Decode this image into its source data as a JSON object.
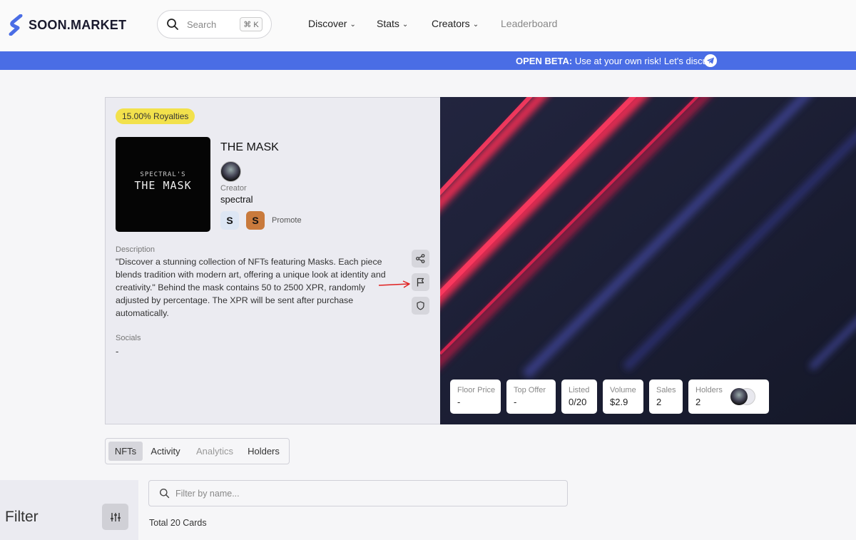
{
  "header": {
    "logo_text": "SOON.MARKET",
    "search_placeholder": "Search",
    "search_shortcut": "⌘ K",
    "nav": [
      {
        "label": "Discover"
      },
      {
        "label": "Stats"
      },
      {
        "label": "Creators"
      },
      {
        "label": "Leaderboard"
      }
    ]
  },
  "banner": {
    "strong": "OPEN BETA:",
    "text": " Use at your own risk! Let's discuss"
  },
  "collection": {
    "royalties": "15.00% Royalties",
    "cover_subtitle": "SPECTRAL'S",
    "cover_title": "THE MASK",
    "title": "THE MASK",
    "creator_label": "Creator",
    "creator_name": "spectral",
    "badge_a": "S",
    "badge_b": "S",
    "promote_label": "Promote",
    "description_label": "Description",
    "description": "\"Discover a stunning collection of NFTs featuring Masks. Each piece blends tradition with modern art, offering a unique look at identity and creativity.\" Behind the mask contains 50 to 2500 XPR, randomly adjusted by percentage. The XPR will be sent after purchase automatically.",
    "socials_label": "Socials",
    "socials_value": "-"
  },
  "stats": {
    "floor_price": {
      "label": "Floor Price",
      "value": "-"
    },
    "top_offer": {
      "label": "Top Offer",
      "value": "-"
    },
    "listed": {
      "label": "Listed",
      "value": "0/20"
    },
    "volume": {
      "label": "Volume",
      "value": "$2.9"
    },
    "sales": {
      "label": "Sales",
      "value": "2"
    },
    "holders": {
      "label": "Holders",
      "value": "2"
    }
  },
  "tabs": [
    {
      "label": "NFTs"
    },
    {
      "label": "Activity"
    },
    {
      "label": "Analytics"
    },
    {
      "label": "Holders"
    }
  ],
  "filter": {
    "title": "Filter",
    "placeholder": "Filter by name...",
    "total": "Total 20 Cards"
  },
  "colors": {
    "banner": "#4a6de5",
    "royalty_badge": "#f2e14c",
    "art_background": "#1a1d33",
    "art_stripe": "#ff2d55"
  }
}
